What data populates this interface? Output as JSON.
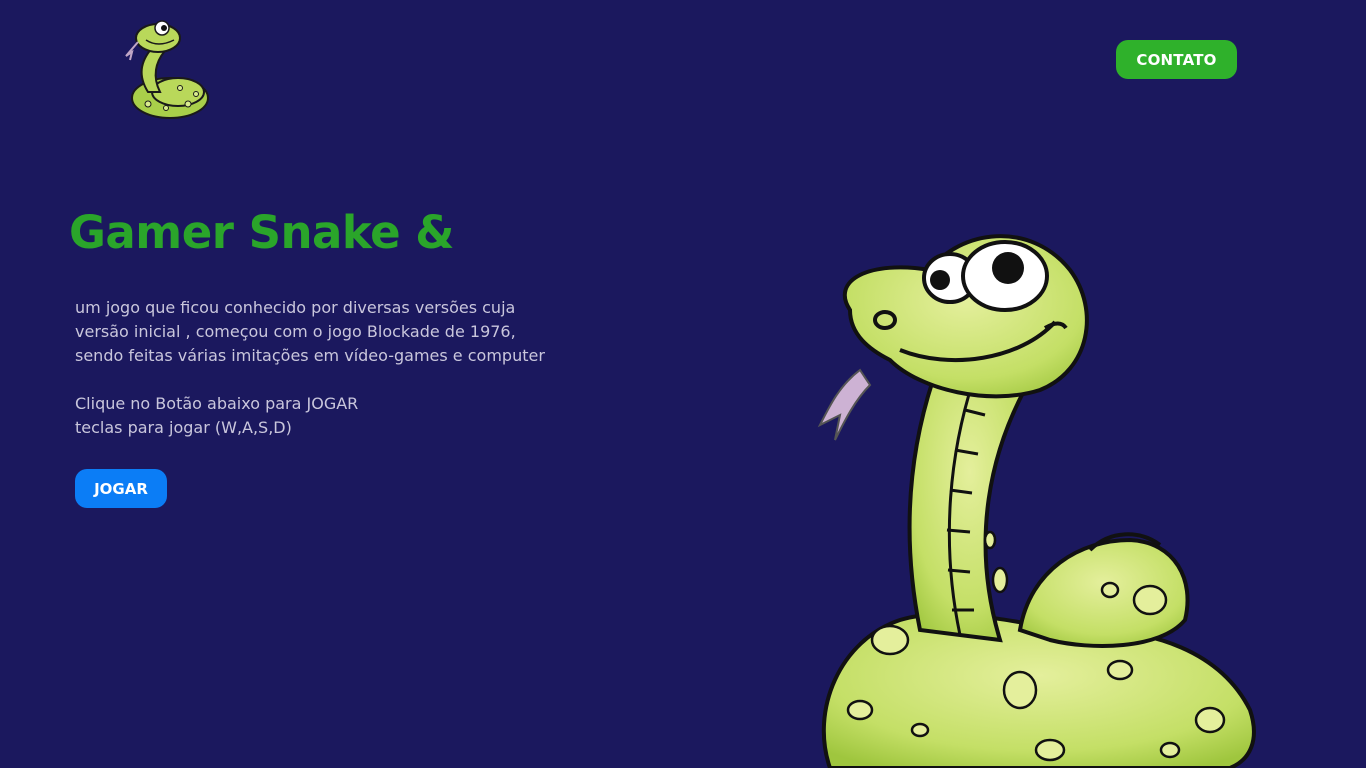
{
  "header": {
    "logo_icon": "snake-logo-icon",
    "contact_label": "CONTATO"
  },
  "hero": {
    "title": "Gamer Snake &",
    "description": {
      "line1": "um jogo que ficou conhecido por diversas versões cuja",
      "line2": "versão inicial , começou com o jogo Blockade de 1976,",
      "line3": "sendo feitas várias imitações em vídeo-games e computer",
      "line4": "Clique no Botão abaixo para JOGAR",
      "line5": "teclas para jogar (W,A,S,D)"
    },
    "play_label": "JOGAR",
    "illustration_icon": "cartoon-snake-illustration"
  },
  "colors": {
    "background": "#1b185e",
    "title": "#2aa52a",
    "contact_button": "#2fb12b",
    "play_button": "#0b7df6",
    "text": "#c9c6dc",
    "snake_body": "#b9d85a",
    "snake_outline": "#111111"
  }
}
